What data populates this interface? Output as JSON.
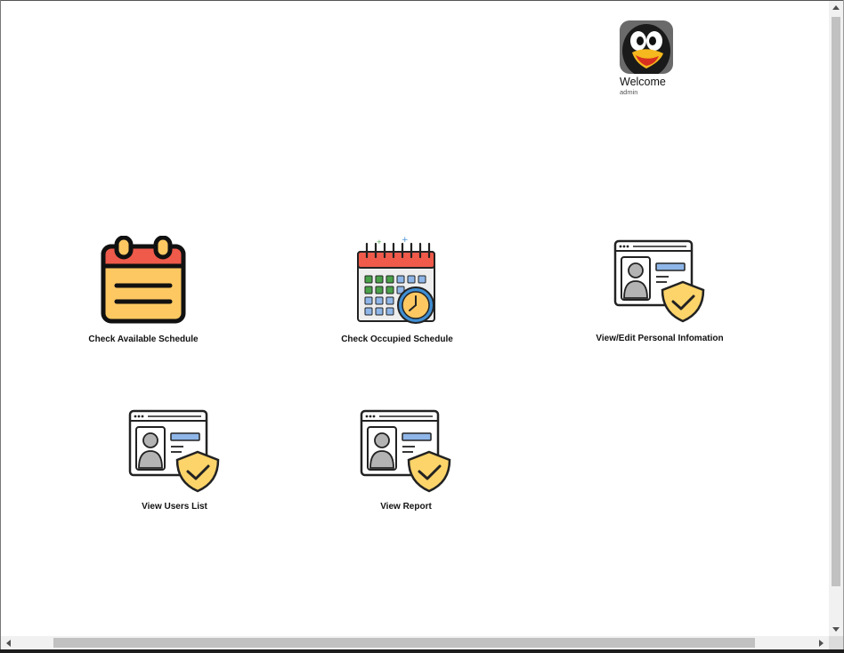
{
  "user": {
    "greeting": "Welcome",
    "username": "admin",
    "avatar_icon": "penguin-avatar-icon"
  },
  "tiles": [
    {
      "label": "Check Available Schedule",
      "icon": "calendar-icon"
    },
    {
      "label": "Check Occupied Schedule",
      "icon": "calendar-clock-icon"
    },
    {
      "label": "View/Edit Personal Infomation",
      "icon": "user-profile-shield-icon"
    },
    {
      "label": "View Users List",
      "icon": "user-profile-shield-icon"
    },
    {
      "label": "View Report",
      "icon": "user-profile-shield-icon"
    }
  ],
  "colors": {
    "calendar_red": "#ef5a4a",
    "calendar_yellow": "#fdc862",
    "shield_yellow": "#fdd46a",
    "accent_blue": "#8fb6e8",
    "clock_blue": "#3f8ed3",
    "check_green": "#4aa14a"
  }
}
